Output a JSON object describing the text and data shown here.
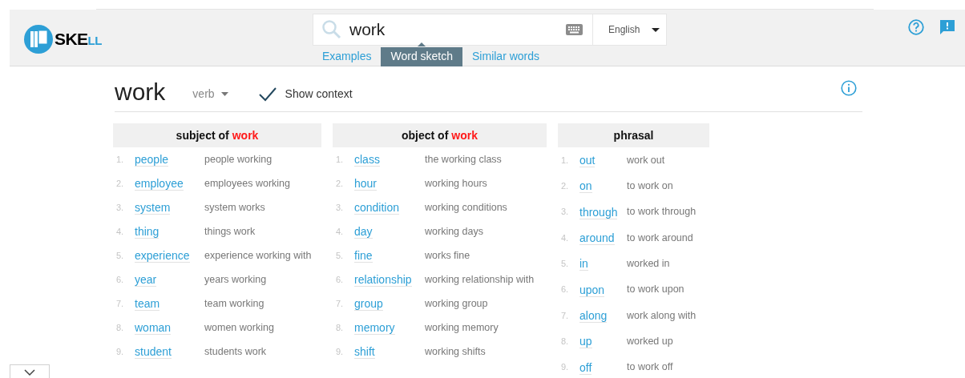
{
  "logo": {
    "text_main": "SKE",
    "text_accent": "LL"
  },
  "search": {
    "value": "work"
  },
  "language": {
    "value": "English"
  },
  "tabs": [
    {
      "label": "Examples",
      "selected": false
    },
    {
      "label": "Word sketch",
      "selected": true
    },
    {
      "label": "Similar words",
      "selected": false
    }
  ],
  "headword": "work",
  "part_of_speech": "verb",
  "show_context": {
    "label": "Show context",
    "checked": true
  },
  "columns": [
    {
      "title": "subject of",
      "keyword": "work",
      "rows": [
        {
          "number": "1.",
          "word": "people",
          "context": "people working"
        },
        {
          "number": "2.",
          "word": "employee",
          "context": "employees working"
        },
        {
          "number": "3.",
          "word": "system",
          "context": "system works"
        },
        {
          "number": "4.",
          "word": "thing",
          "context": "things work"
        },
        {
          "number": "5.",
          "word": "experience",
          "context": "experience working with"
        },
        {
          "number": "6.",
          "word": "year",
          "context": "years working"
        },
        {
          "number": "7.",
          "word": "team",
          "context": "team working"
        },
        {
          "number": "8.",
          "word": "woman",
          "context": "women working"
        },
        {
          "number": "9.",
          "word": "student",
          "context": "students work"
        }
      ]
    },
    {
      "title": "object of",
      "keyword": "work",
      "rows": [
        {
          "number": "1.",
          "word": "class",
          "context": "the working class"
        },
        {
          "number": "2.",
          "word": "hour",
          "context": "working hours"
        },
        {
          "number": "3.",
          "word": "condition",
          "context": "working conditions"
        },
        {
          "number": "4.",
          "word": "day",
          "context": "working days"
        },
        {
          "number": "5.",
          "word": "fine",
          "context": "works fine"
        },
        {
          "number": "6.",
          "word": "relationship",
          "context": "working relationship with"
        },
        {
          "number": "7.",
          "word": "group",
          "context": "working group"
        },
        {
          "number": "8.",
          "word": "memory",
          "context": "working memory"
        },
        {
          "number": "9.",
          "word": "shift",
          "context": "working shifts"
        }
      ]
    },
    {
      "title": "phrasal",
      "rows": [
        {
          "number": "1.",
          "word": "out",
          "context": "work out"
        },
        {
          "number": "2.",
          "word": "on",
          "context": "to work on"
        },
        {
          "number": "3.",
          "word": "through",
          "context": "to work through"
        },
        {
          "number": "4.",
          "word": "around",
          "context": "to work around"
        },
        {
          "number": "5.",
          "word": "in",
          "context": "worked in"
        },
        {
          "number": "6.",
          "word": "upon",
          "context": "to work upon"
        },
        {
          "number": "7.",
          "word": "along",
          "context": "work along with"
        },
        {
          "number": "8.",
          "word": "up",
          "context": "worked up"
        },
        {
          "number": "9.",
          "word": "off",
          "context": "to work off"
        }
      ]
    }
  ]
}
